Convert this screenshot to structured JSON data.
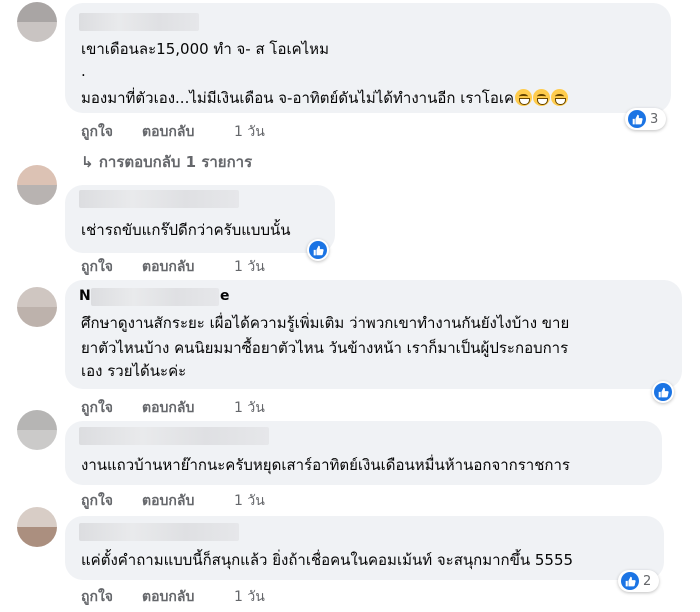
{
  "actions": {
    "like": "ถูกใจ",
    "reply": "ตอบกลับ",
    "time": "1 วัน"
  },
  "comments": [
    {
      "text_lines": [
        "เขาเดือนละ15,000 ทำ จ- ส โอเคไหม",
        ".",
        "มองมาที่ตัวเอง...ไม่มีเงินเดือน จ-อาทิตย์ดันไม่ได้ทำงานอีก เราโอเค"
      ],
      "reaction_count": "3",
      "emoji": "grinning-face"
    },
    {
      "text_lines": [
        "เช่ารถขับแกร๊ปดีกว่าครับแบบนั้น"
      ],
      "reaction_count": ""
    },
    {
      "name_fragments": [
        "N",
        "e"
      ],
      "text_lines": [
        "ศึกษาดูงานสักระยะ เผื่อได้ความรู้เพิ่มเติม ว่าพวกเขาทำงานกันยังไงบ้าง ขาย",
        "ยาตัวไหนบ้าง คนนิยมมาซื้อยาตัวไหน วันข้างหน้า เราก็มาเป็นผู้ประกอบการ",
        "เอง รวยได้นะค่ะ"
      ],
      "reaction_count": ""
    },
    {
      "text_lines": [
        "งานแถวบ้านหาย๊ากนะครับหยุดเสาร์อาทิตย์เงินเดือนหมื่นห้านอกจากราชการ"
      ],
      "reaction_count": ""
    },
    {
      "text_lines": [
        "แค่ตั้งคำถามแบบนี้ก็สนุกแล้ว ยิ่งถ้าเชื่อคนในคอมเม้นท์ จะสนุกมากขึ้น 5555"
      ],
      "reaction_count": "2"
    }
  ],
  "replies_link": {
    "arrow": "↳",
    "text": "การตอบกลับ 1 รายการ"
  },
  "colors": {
    "bubble": "#f0f2f5",
    "meta": "#65676b",
    "like_blue": "#1b74e4",
    "text": "#050505"
  },
  "icons": {
    "like": "thumbs-up-icon",
    "reply_arrow": "reply-arrow-icon"
  }
}
